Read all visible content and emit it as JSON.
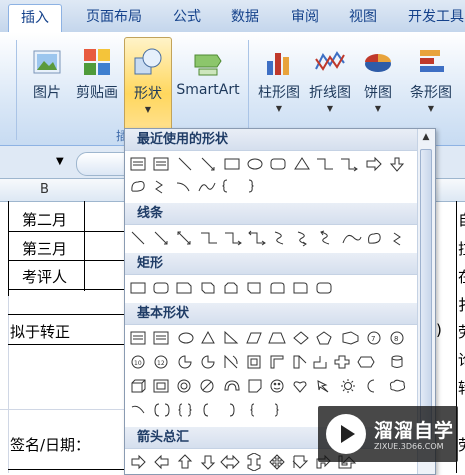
{
  "tabs": [
    "插入",
    "页面布局",
    "公式",
    "数据",
    "审阅",
    "视图",
    "开发工具"
  ],
  "active_tab": "插入",
  "ribbon": {
    "buttons": [
      {
        "label": "图片",
        "icon": "picture-icon"
      },
      {
        "label": "剪贴画",
        "icon": "clipart-icon"
      },
      {
        "label": "形状",
        "icon": "shapes-icon",
        "active": true
      },
      {
        "label": "SmartArt",
        "icon": "smartart-icon"
      },
      {
        "label": "柱形图",
        "icon": "column-chart-icon"
      },
      {
        "label": "折线图",
        "icon": "line-chart-icon"
      },
      {
        "label": "饼图",
        "icon": "pie-chart-icon"
      },
      {
        "label": "条形图",
        "icon": "bar-chart-icon"
      }
    ],
    "group_label": "插"
  },
  "sheet": {
    "column_header": "B",
    "cells": [
      "第二月",
      "第三月",
      "考评人",
      "拟于转正",
      "签名/日期："
    ],
    "right_col": [
      "自",
      "拉",
      "在",
      "扌",
      "劳",
      "论",
      "转",
      "劳"
    ],
    "paren": ")"
  },
  "gallery": {
    "sections": [
      "最近使用的形状",
      "线条",
      "矩形",
      "基本形状",
      "箭头总汇"
    ]
  },
  "watermark": {
    "title": "溜溜自学",
    "url": "ZIXUE.3D66.COM"
  },
  "colors": {
    "tab_text": "#15428b",
    "active_button": "#ffd75e",
    "section_header": "#d5dfee"
  }
}
